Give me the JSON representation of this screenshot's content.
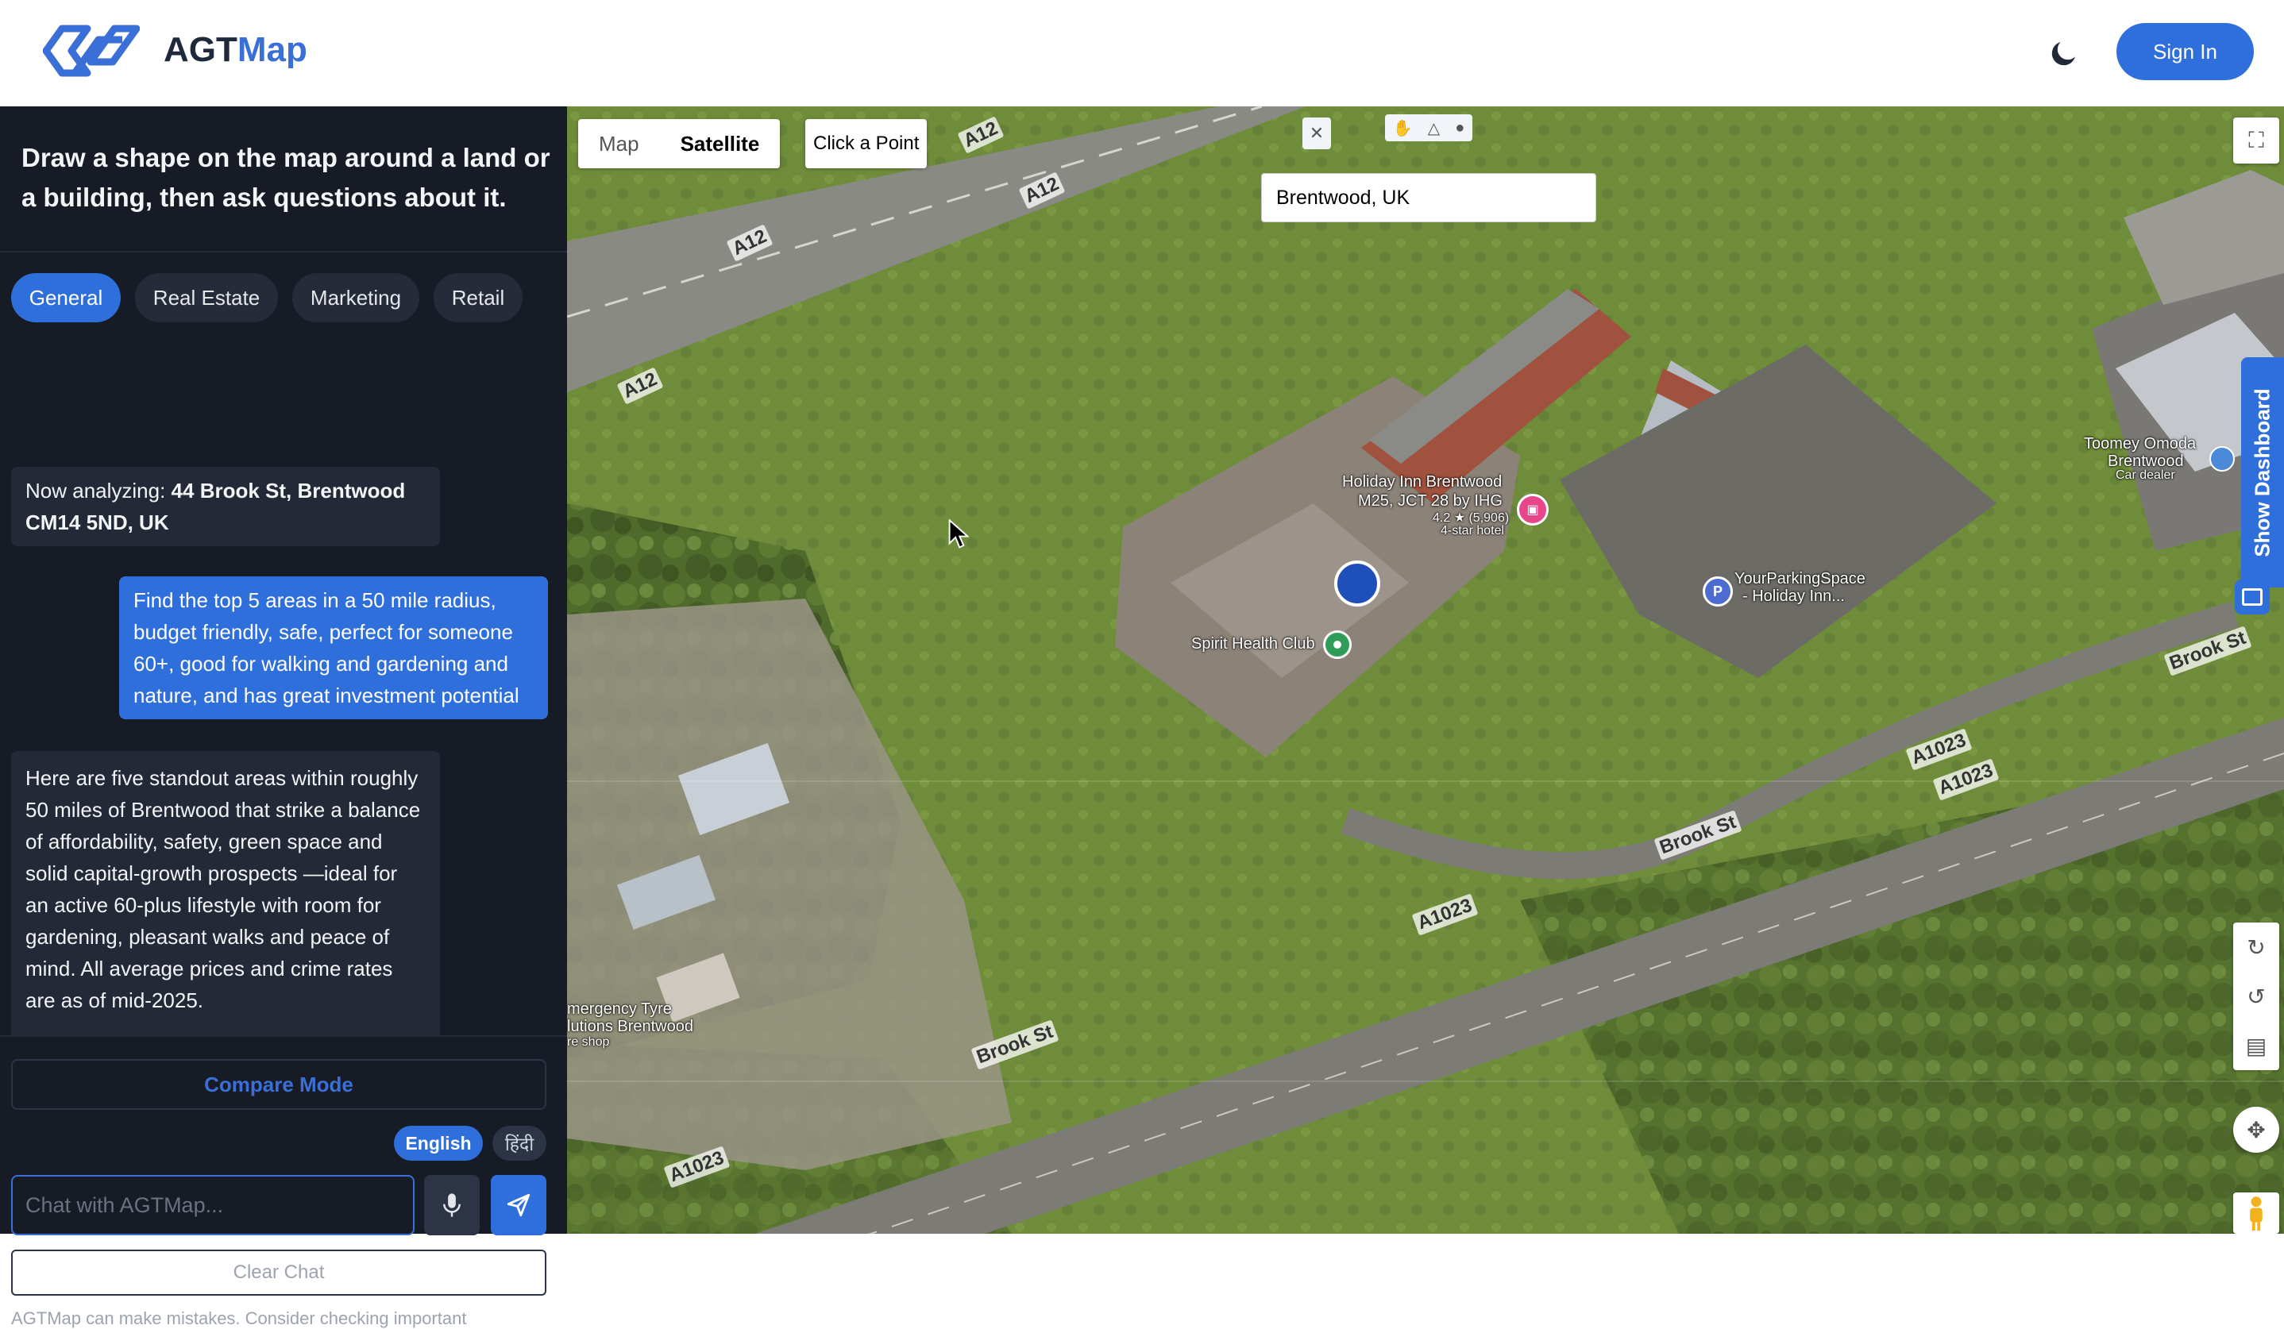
{
  "header": {
    "brand_part1": "AGT",
    "brand_part2": "Map",
    "sign_in": "Sign In"
  },
  "sidebar": {
    "intro": "Draw a shape on the map around a land or a building, then ask questions about it.",
    "tabs": [
      {
        "label": "General",
        "active": true
      },
      {
        "label": "Real Estate",
        "active": false
      },
      {
        "label": "Marketing",
        "active": false
      },
      {
        "label": "Retail",
        "active": false
      }
    ],
    "messages": [
      {
        "role": "bot",
        "prefix": "Now analyzing: ",
        "bold": "44 Brook St, Brentwood CM14 5ND, UK"
      },
      {
        "role": "user",
        "text": "Find the top 5 areas in a 50 mile radius, budget friendly, safe, perfect for someone 60+, good for walking and gardening and nature, and has great investment potential"
      },
      {
        "role": "bot",
        "text": "Here are five standout areas within roughly 50 miles of Brentwood that strike a balance of affordability, safety, green space and solid capital-growth prospects —ideal for an active 60-plus lifestyle with room for gardening, pleasant walks and peace of mind. All average prices and crime rates are as of mid-2025."
      }
    ],
    "compare_mode": "Compare Mode",
    "languages": [
      "English",
      "हिंदी"
    ],
    "chat_placeholder": "Chat with AGTMap...",
    "clear_chat": "Clear Chat",
    "disclaimer": "AGTMap can make mistakes. Consider checking important"
  },
  "map": {
    "map_types": [
      "Map",
      "Satellite"
    ],
    "selected_type": "Satellite",
    "click_point": "Click a Point",
    "search_value": "Brentwood, UK",
    "show_dashboard": "Show Dashboard",
    "labels": {
      "holiday_inn": "Holiday Inn Brentwood",
      "holiday_inn_sub": "M25, JCT 28 by IHG",
      "holiday_inn_rating": "4.2 ★ (5,906)",
      "holiday_inn_type": "4-star hotel",
      "spirit": "Spirit Health Club",
      "parking": "YourParkingSpace",
      "parking_sub": "- Holiday Inn...",
      "toomey": "Toomey Omoda",
      "toomey_sub": "Brentwood",
      "toomey_type": "Car dealer",
      "tyre": "mergency Tyre",
      "tyre_sub": "lutions Brentwood",
      "tyre_type": "re shop"
    },
    "roads": [
      "A12",
      "A12",
      "A12",
      "A12",
      "A1023",
      "A1023",
      "A1023",
      "A1023",
      "Brook St",
      "Brook St",
      "Brook St"
    ]
  },
  "colors": {
    "primary": "#2f6fdc",
    "sidebar_bg": "#171b26",
    "bubble_bg": "#232937"
  }
}
